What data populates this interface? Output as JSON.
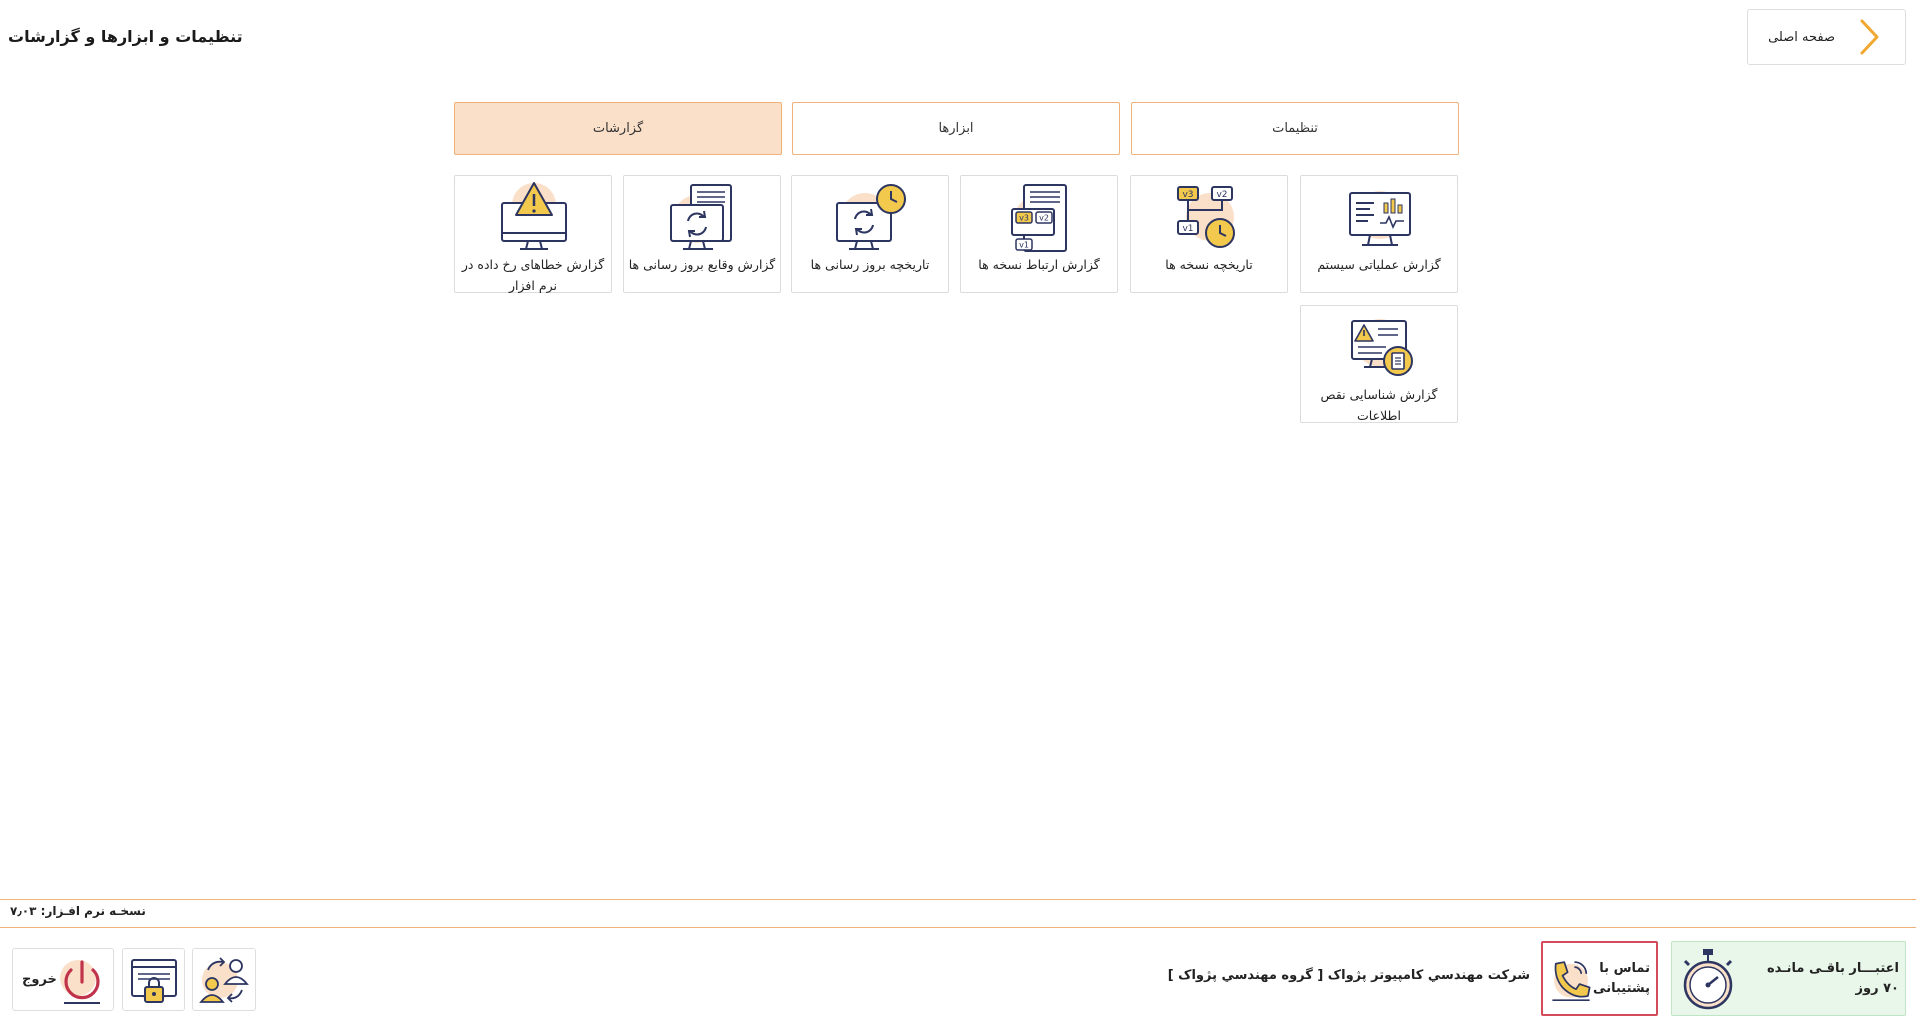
{
  "header": {
    "title": "تنظیمات و ابزارها و گزارشات",
    "home_label": "صفحه اصلی",
    "home_icon": "chevron-right-icon"
  },
  "tabs": [
    {
      "label": "گزارشات",
      "active": true
    },
    {
      "label": "ابزارها",
      "active": false
    },
    {
      "label": "تنظیمات",
      "active": false
    }
  ],
  "cards": [
    {
      "label": "گزارش عملیاتی سیستم",
      "icon": "monitor-stats-icon"
    },
    {
      "label": "تاریخچه نسخه ها",
      "icon": "version-history-icon"
    },
    {
      "label": "گزارش ارتباط نسخه ها",
      "icon": "version-relations-icon"
    },
    {
      "label": "تاریخچه بروز رسانی ها",
      "icon": "update-history-icon"
    },
    {
      "label": "گزارش وقایع بروز رسانی ها",
      "icon": "update-events-icon"
    },
    {
      "label": "گزارش خطاهای رخ داده در نرم افزار",
      "icon": "error-warning-icon"
    },
    {
      "label": "گزارش شناسایی نقص اطلاعات",
      "icon": "data-defect-icon"
    }
  ],
  "footer": {
    "version": "نسخـه نرم افـزار: ۷٫۰۳",
    "credit_line1": "اعتبـــار باقـی مانـده",
    "credit_line2": "۷۰ روز",
    "support_line1": "تماس با",
    "support_line2": "پشتیبانی",
    "company": "شرکت مهندسي کامپيوتر پژواک [ گروه مهندسي پژواک ]",
    "exit_label": "خروج"
  },
  "colors": {
    "accent": "#f0b27a",
    "active_tab": "#fbe0c9",
    "icon_yellow": "#f2c94c",
    "icon_navy": "#2d3561",
    "support_border": "#d44b5a",
    "credit_bg": "#e8f7ea"
  }
}
